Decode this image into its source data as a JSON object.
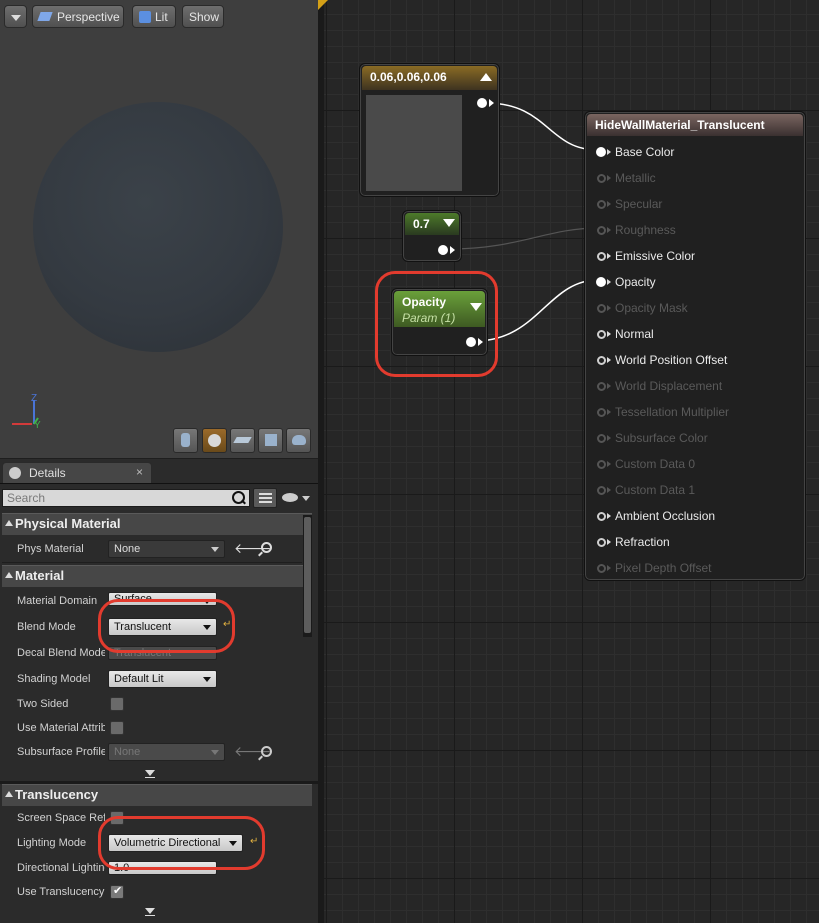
{
  "viewport": {
    "perspective_label": "Perspective",
    "lit_label": "Lit",
    "show_label": "Show",
    "axis_z": "Z",
    "axis_y": "Y"
  },
  "details": {
    "tab_label": "Details",
    "search_placeholder": "Search",
    "sections": {
      "physical_material": "Physical Material",
      "material": "Material",
      "translucency": "Translucency"
    },
    "properties": {
      "phys_material": {
        "label": "Phys Material",
        "value": "None"
      },
      "material_domain": {
        "label": "Material Domain",
        "value": "Surface"
      },
      "blend_mode": {
        "label": "Blend Mode",
        "value": "Translucent"
      },
      "decal_blend_mode": {
        "label": "Decal Blend Mode",
        "value": "Translucent"
      },
      "shading_model": {
        "label": "Shading Model",
        "value": "Default Lit"
      },
      "two_sided": {
        "label": "Two Sided"
      },
      "use_material_attributes": {
        "label": "Use Material Attributes"
      },
      "subsurface_profile": {
        "label": "Subsurface Profile",
        "value": "None"
      },
      "screen_space_reflections": {
        "label": "Screen Space Reflections"
      },
      "lighting_mode": {
        "label": "Lighting Mode",
        "value": "Volumetric Directional"
      },
      "directional_lighting": {
        "label": "Directional Lighting Intensity",
        "value": "1.0"
      },
      "use_translucency": {
        "label": "Use Translucency Vertex Fog"
      }
    }
  },
  "graph": {
    "constant3": {
      "label": "0.06,0.06,0.06",
      "color": "#4a4a4a"
    },
    "constant": {
      "label": "0.7"
    },
    "param": {
      "name": "Opacity",
      "subtitle": "Param (1)"
    },
    "material_node": {
      "title": "HideWallMaterial_Translucent",
      "pins": [
        {
          "label": "Base Color",
          "active": true
        },
        {
          "label": "Metallic",
          "active": false
        },
        {
          "label": "Specular",
          "active": false
        },
        {
          "label": "Roughness",
          "active": false
        },
        {
          "label": "Emissive Color",
          "active": true
        },
        {
          "label": "Opacity",
          "active": true
        },
        {
          "label": "Opacity Mask",
          "active": false
        },
        {
          "label": "Normal",
          "active": true
        },
        {
          "label": "World Position Offset",
          "active": true
        },
        {
          "label": "World Displacement",
          "active": false
        },
        {
          "label": "Tessellation Multiplier",
          "active": false
        },
        {
          "label": "Subsurface Color",
          "active": false
        },
        {
          "label": "Custom Data 0",
          "active": false
        },
        {
          "label": "Custom Data 1",
          "active": false
        },
        {
          "label": "Ambient Occlusion",
          "active": true
        },
        {
          "label": "Refraction",
          "active": true
        },
        {
          "label": "Pixel Depth Offset",
          "active": false
        }
      ]
    }
  },
  "colors": {
    "highlight_ring": "#e23b2e",
    "param_green": "#5f8a2c",
    "constant_gold": "#8a6b24",
    "result_node_header": "#5a4a45"
  }
}
